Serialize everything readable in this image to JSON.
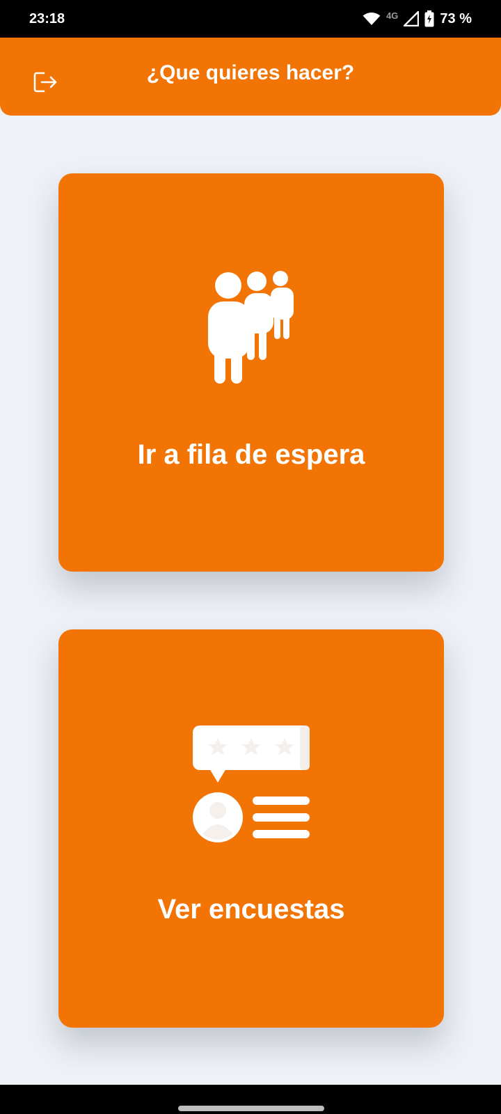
{
  "status_bar": {
    "time": "23:18",
    "network": "4G",
    "battery": "73 %",
    "icons": [
      "wifi-icon",
      "signal-icon",
      "battery-charging-icon"
    ]
  },
  "header": {
    "title": "¿Que quieres hacer?",
    "logout_icon": "logout-icon"
  },
  "cards": [
    {
      "label": "Ir a fila de espera",
      "icon": "queue-people-icon"
    },
    {
      "label": "Ver encuestas",
      "icon": "survey-rating-icon"
    }
  ],
  "colors": {
    "primary": "#f27405",
    "background": "#eef1f6",
    "text_on_primary": "#ffffff",
    "icon_accent": "#f5f0eb"
  }
}
